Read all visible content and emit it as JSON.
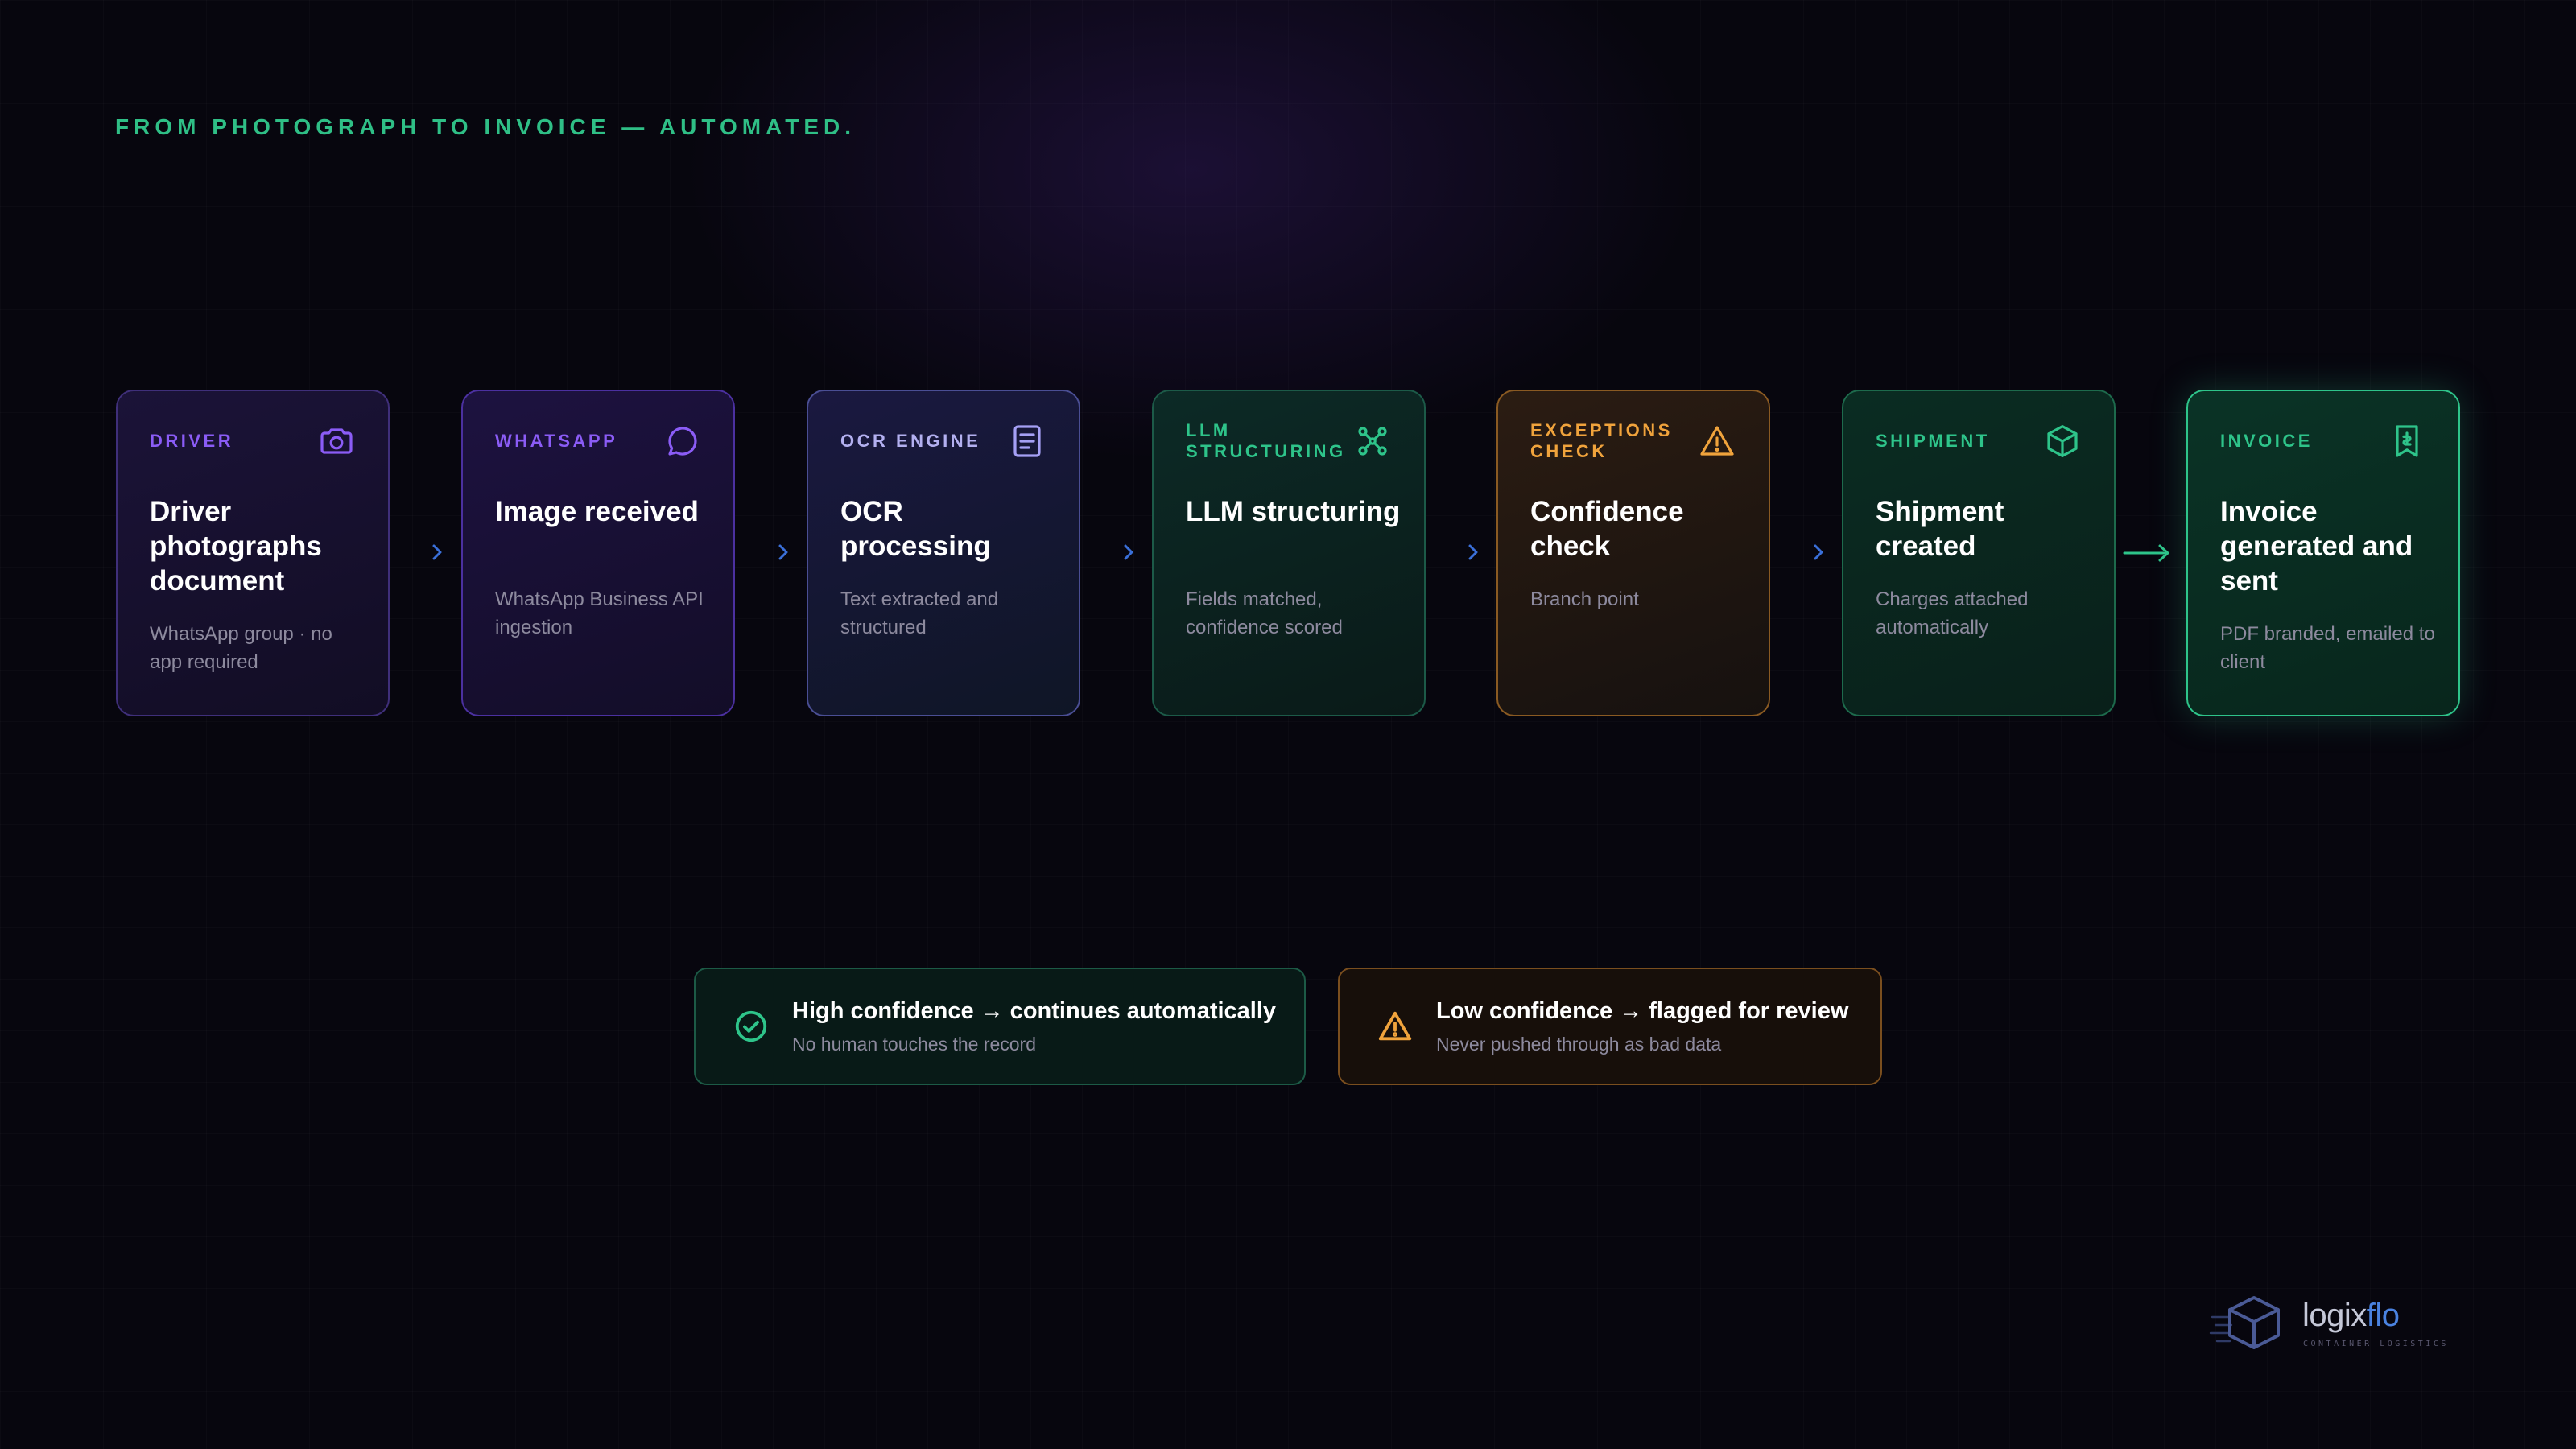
{
  "header": {
    "eyebrow": "FROM PHOTOGRAPH TO INVOICE — AUTOMATED."
  },
  "pipeline": [
    {
      "tag": "DRIVER",
      "title": "Driver photographs document",
      "desc": "WhatsApp group · no app required",
      "icon": "camera-icon",
      "accent": "#8b5cf6"
    },
    {
      "tag": "WHATSAPP",
      "title": "Image received",
      "desc": "WhatsApp Business API ingestion",
      "icon": "chat-bubble-icon",
      "accent": "#8b5cf6"
    },
    {
      "tag": "OCR ENGINE",
      "title": "OCR processing",
      "desc": "Text extracted and structured",
      "icon": "document-icon",
      "accent": "#a5a0f5"
    },
    {
      "tag": "LLM STRUCTURING",
      "title": "LLM structuring",
      "desc": "Fields matched, confidence scored",
      "icon": "network-nodes-icon",
      "accent": "#2ec48a"
    },
    {
      "tag": "EXCEPTIONS CHECK",
      "title": "Confidence check",
      "desc": "Branch point",
      "icon": "warning-triangle-icon",
      "accent": "#f0a33c"
    },
    {
      "tag": "SHIPMENT",
      "title": "Shipment created",
      "desc": "Charges attached automatically",
      "icon": "package-box-icon",
      "accent": "#2ec48a"
    },
    {
      "tag": "INVOICE",
      "title": "Invoice generated and sent",
      "desc": "PDF branded, emailed to client",
      "icon": "receipt-icon",
      "accent": "#2ec48a"
    }
  ],
  "outcomes": {
    "high": {
      "title": "High confidence → continues automatically",
      "subtitle": "No human touches the record",
      "icon": "check-circle-icon",
      "accent": "#2ec48a"
    },
    "low": {
      "title": "Low confidence → flagged for review",
      "subtitle": "Never pushed through as bad data",
      "icon": "warning-triangle-icon",
      "accent": "#f0a33c"
    }
  },
  "brand": {
    "name_primary": "logix",
    "name_accent": "flo",
    "tagline": "CONTAINER LOGISTICS",
    "primary_color": "#c5c8d8",
    "accent_color": "#4a82e0"
  }
}
